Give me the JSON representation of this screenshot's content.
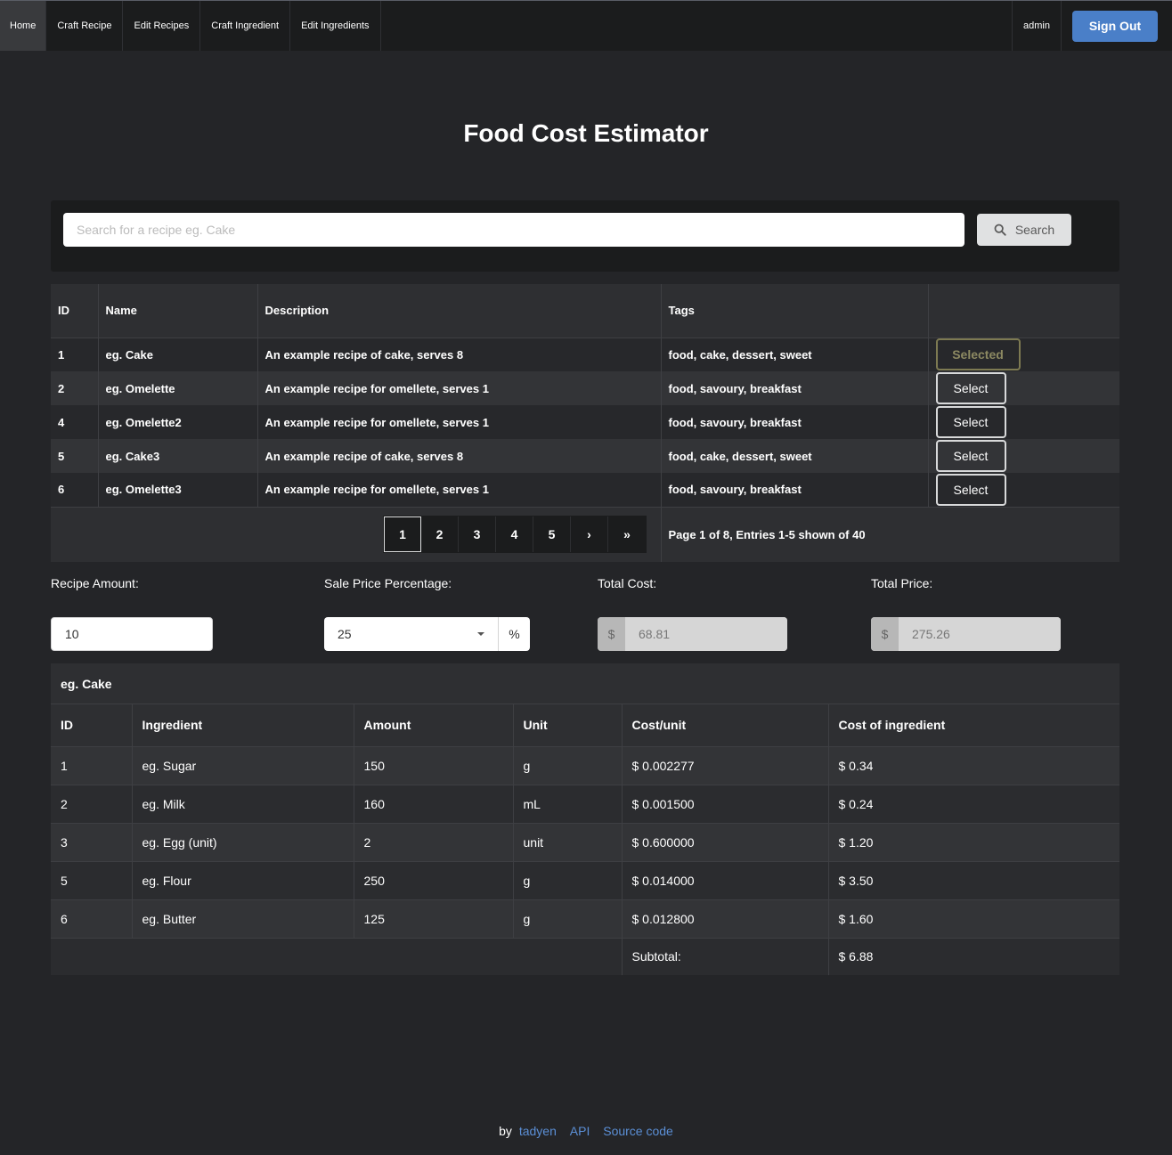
{
  "nav": {
    "items": [
      {
        "label": "Home",
        "active": true
      },
      {
        "label": "Craft Recipe",
        "active": false
      },
      {
        "label": "Edit Recipes",
        "active": false
      },
      {
        "label": "Craft Ingredient",
        "active": false
      },
      {
        "label": "Edit Ingredients",
        "active": false
      }
    ],
    "user": "admin",
    "signout_label": "Sign Out"
  },
  "page_title": "Food Cost Estimator",
  "search": {
    "placeholder": "Search for a recipe eg. Cake",
    "value": "",
    "button_label": "Search"
  },
  "recipes": {
    "headers": [
      "ID",
      "Name",
      "Description",
      "Tags",
      ""
    ],
    "rows": [
      {
        "id": "1",
        "name": "eg. Cake",
        "description": "An example recipe of cake, serves 8",
        "tags": "food, cake, dessert, sweet",
        "action": "Selected",
        "selected": true
      },
      {
        "id": "2",
        "name": "eg. Omelette",
        "description": "An example recipe for omellete, serves 1",
        "tags": "food, savoury, breakfast",
        "action": "Select",
        "selected": false
      },
      {
        "id": "4",
        "name": "eg. Omelette2",
        "description": "An example recipe for omellete, serves 1",
        "tags": "food, savoury, breakfast",
        "action": "Select",
        "selected": false
      },
      {
        "id": "5",
        "name": "eg. Cake3",
        "description": "An example recipe of cake, serves 8",
        "tags": "food, cake, dessert, sweet",
        "action": "Select",
        "selected": false
      },
      {
        "id": "6",
        "name": "eg. Omelette3",
        "description": "An example recipe for omellete, serves 1",
        "tags": "food, savoury, breakfast",
        "action": "Select",
        "selected": false
      }
    ],
    "pagination": {
      "pages": [
        "1",
        "2",
        "3",
        "4",
        "5"
      ],
      "current": "1",
      "next": "›",
      "last": "»",
      "info": "Page 1 of 8, Entries 1-5 shown of 40"
    }
  },
  "controls": {
    "recipe_amount_label": "Recipe Amount:",
    "recipe_amount_value": "10",
    "sale_pct_label": "Sale Price Percentage:",
    "sale_pct_value": "25",
    "sale_pct_symbol": "%",
    "total_cost_label": "Total Cost:",
    "total_cost_currency": "$",
    "total_cost_value": "68.81",
    "total_price_label": "Total Price:",
    "total_price_currency": "$",
    "total_price_value": "275.26"
  },
  "ingredients": {
    "recipe_name": "eg. Cake",
    "headers": [
      "ID",
      "Ingredient",
      "Amount",
      "Unit",
      "Cost/unit",
      "Cost of ingredient"
    ],
    "rows": [
      {
        "id": "1",
        "name": "eg. Sugar",
        "amount": "150",
        "unit": "g",
        "cost_unit": "$ 0.002277",
        "cost": "$ 0.34"
      },
      {
        "id": "2",
        "name": "eg. Milk",
        "amount": "160",
        "unit": "mL",
        "cost_unit": "$ 0.001500",
        "cost": "$ 0.24"
      },
      {
        "id": "3",
        "name": "eg. Egg (unit)",
        "amount": "2",
        "unit": "unit",
        "cost_unit": "$ 0.600000",
        "cost": "$ 1.20"
      },
      {
        "id": "5",
        "name": "eg. Flour",
        "amount": "250",
        "unit": "g",
        "cost_unit": "$ 0.014000",
        "cost": "$ 3.50"
      },
      {
        "id": "6",
        "name": "eg. Butter",
        "amount": "125",
        "unit": "g",
        "cost_unit": "$ 0.012800",
        "cost": "$ 1.60"
      }
    ],
    "subtotal_label": "Subtotal:",
    "subtotal_value": "$ 6.88"
  },
  "footer": {
    "by": "by",
    "author": "tadyen",
    "api": "API",
    "source": "Source code"
  },
  "colors": {
    "background": "#242528",
    "nav": "#1b1c1d",
    "signout": "#4a7fc8",
    "link": "#5b8fd6",
    "selected_button": "#7d7a52"
  }
}
